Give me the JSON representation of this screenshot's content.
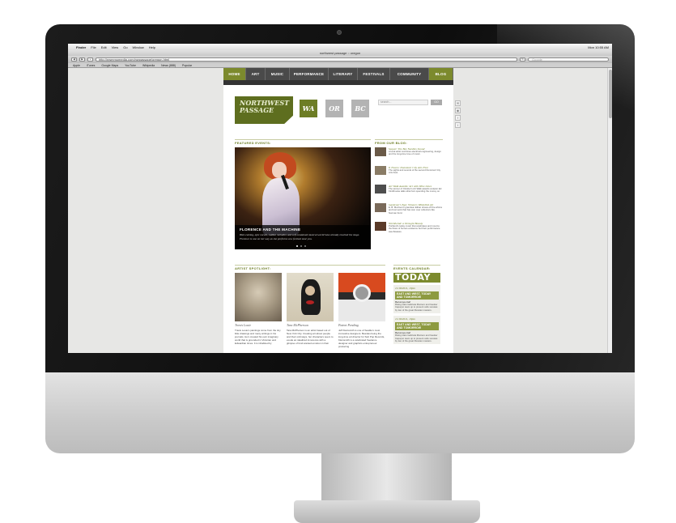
{
  "os_menu": {
    "items": [
      "",
      "Finder",
      "File",
      "Edit",
      "View",
      "Go",
      "Window",
      "Help"
    ],
    "clock": "Mon 10:55 AM"
  },
  "browser": {
    "window_title": "northwest passage :: oregon",
    "url": "http://nwmmomedia.com/nwpassage/oregon.html",
    "search_placeholder": "Google",
    "bookmarks": [
      "Apple",
      "iTunes",
      "Google Maps",
      "YouTube",
      "Wikipedia",
      "News (888)",
      "Popular"
    ]
  },
  "site": {
    "nav": [
      "HOME",
      "ART",
      "MUSIC",
      "PERFORMANCE",
      "LITERARY",
      "FESTIVALS",
      "COMMUNITY",
      "BLOG"
    ],
    "logo_line1": "NORTHWEST",
    "logo_line2": "PASSAGE",
    "regions": [
      "WA",
      "OR",
      "BC"
    ],
    "search_placeholder": "search...",
    "search_button": "GO",
    "featured_label": "FEATURED EVENTS:",
    "featured_title": "FLORENCE AND THE MACHINE",
    "featured_text": "Hair-raising, epic vocals, sudden melodies and self-contained musical world have already reached the stage. Florence is one on her way as she performs at a festival near you.",
    "blog_label": "FROM OUR BLOG:",
    "blog_items": [
      {
        "title": "Sequel: The Bee Needles Sound",
        "text": "A local artist combines electrical engineering, design and the long-time love of music."
      },
      {
        "title": "It Traces: Dunsmuir City Arts Fest",
        "text": "The sights and sounds of the second Dunsmuir City Arts Fest."
      },
      {
        "title": "Art Walk Awards: Art with Wine Lines",
        "text": "The winner of October's Art Walk awards sculptor Ed Kindbrooke talks what he's spending the money on."
      },
      {
        "title": "Gardener's Ego: Winners Wildchild Art",
        "text": "E. B. Morrison's grandson Ethan shows off the whims and lost work that has won over collectors like Norman Ford."
      },
      {
        "title": "Worldwind: a Drought Beauty",
        "text": "Portland's today music that celebrates and mourns the flows of human existence but their performance was flawless."
      }
    ],
    "artist_label": "ARTIST SPOTLIGHT:",
    "artists": [
      {
        "name": "Travis Louie",
        "text": "Travis Louie's paintings come from the tiny little drawings and many writings in his journals. He's created his own imaginary world that is grounded in Victorian and Edwardian times. It is inhabited by"
      },
      {
        "name": "Tara McPherson",
        "text": "Tara McPherson is an artist based out of New York City. Creating art about people and their odd ways, her characters seem to exude an idealized innocence with a glimpse of fond wanted emotion in their"
      },
      {
        "name": "Patent Pending",
        "text": "Jeff Kleinsmith is one of Seattle's most innovative designers. Besides being the long-time art director for Sub Pop Records, Kleinsmith is a celebrated freelance designer and graphics entrepreneur producing"
      }
    ],
    "events_label": "EVENTS CALENDAR:",
    "today_label": "TODAY",
    "events": [
      {
        "date": "11/18/2011, 10pm",
        "head": "EAST AND WEST, TODAY AND TOMORROW",
        "venue": "Benaroya Hall",
        "text": "Rising stars Gabriela Montero and Gautier Capuçon team up to present cello sonatas by two of the great Russian masters."
      },
      {
        "date": "11/18/2011, 10pm",
        "head": "EAST AND WEST, TODAY AND TOMORROW",
        "venue": "Benaroya Hall",
        "text": "Rising stars Gabriela Montero and Gautier Capuçon team up to present cello sonatas by two of the great Russian masters."
      }
    ],
    "social": [
      "✉",
      "◉",
      "f",
      "t"
    ]
  },
  "colors": {
    "accent": "#7c8a2d",
    "nav_bg": "#4a4a4a",
    "logo_bg": "#5e6e1f"
  }
}
